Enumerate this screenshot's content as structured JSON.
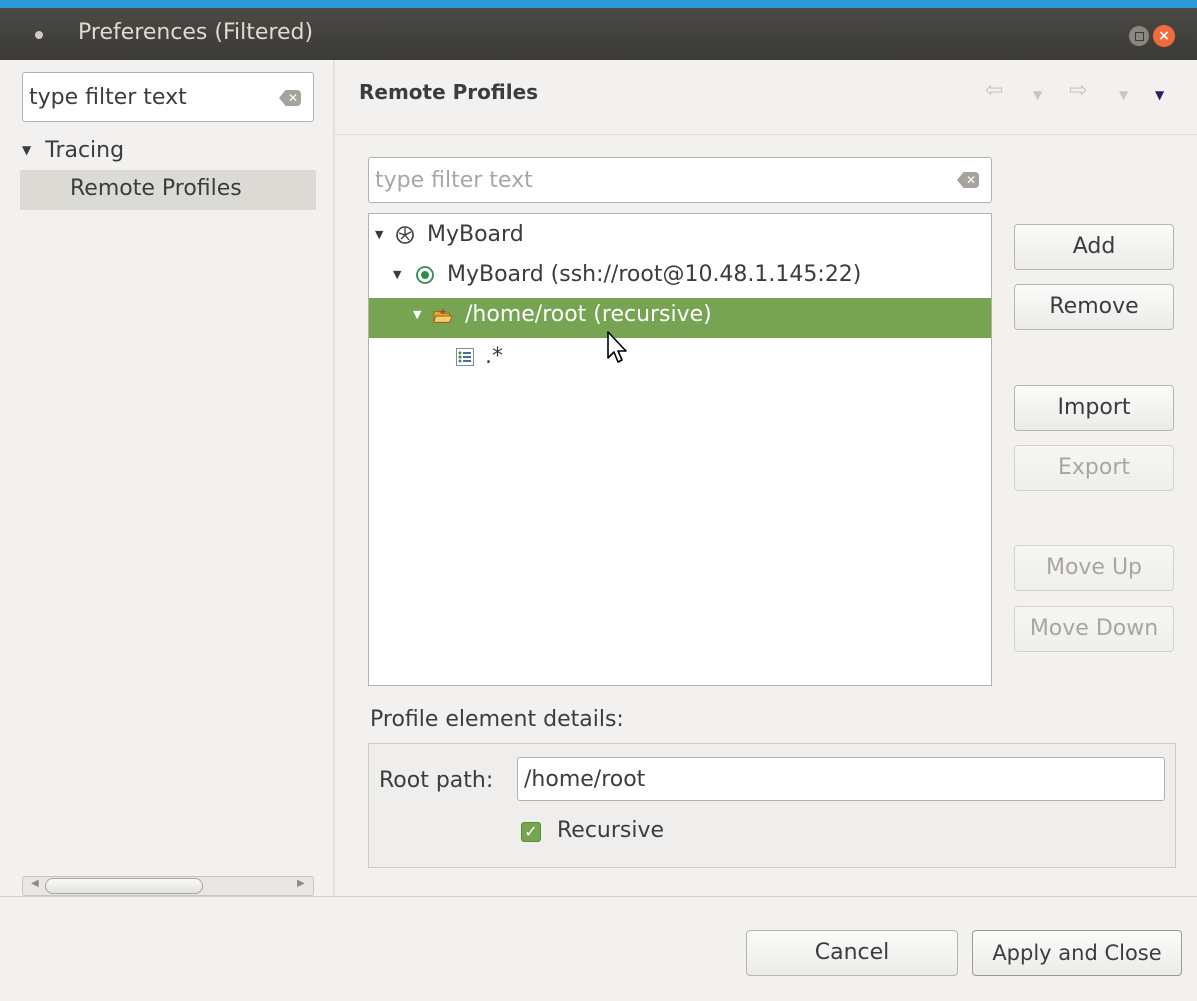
{
  "window": {
    "title": "Preferences (Filtered)",
    "accent": "#2a9bd6"
  },
  "sidebar": {
    "filter_placeholder": "type filter text",
    "filter_value": "type filter text",
    "items": [
      {
        "label": "Tracing",
        "expanded": true
      },
      {
        "label": "Remote Profiles",
        "selected": true
      }
    ]
  },
  "page": {
    "title": "Remote Profiles",
    "nav": {
      "back": "⇦",
      "forward": "⇨",
      "dropdown": "▼"
    }
  },
  "profile_filter": {
    "placeholder": "type filter text",
    "value": ""
  },
  "tree": {
    "nodes": [
      {
        "label": "MyBoard",
        "icon": "profile-icon",
        "level": 0
      },
      {
        "label": "MyBoard (ssh://root@10.48.1.145:22)",
        "icon": "connection-icon",
        "level": 1
      },
      {
        "label": "/home/root (recursive)",
        "icon": "folder-icon",
        "level": 2,
        "selected": true
      },
      {
        "label": ".*",
        "icon": "trace-group-icon",
        "level": 3
      }
    ],
    "selection_color": "#77a452"
  },
  "buttons": {
    "add": "Add",
    "remove": "Remove",
    "import": "Import",
    "export": "Export",
    "move_up": "Move Up",
    "move_down": "Move Down"
  },
  "details": {
    "heading": "Profile element details:",
    "root_path_label": "Root path:",
    "root_path_value": "/home/root",
    "recursive_label": "Recursive",
    "recursive_checked": true
  },
  "footer": {
    "cancel": "Cancel",
    "apply": "Apply and Close"
  }
}
